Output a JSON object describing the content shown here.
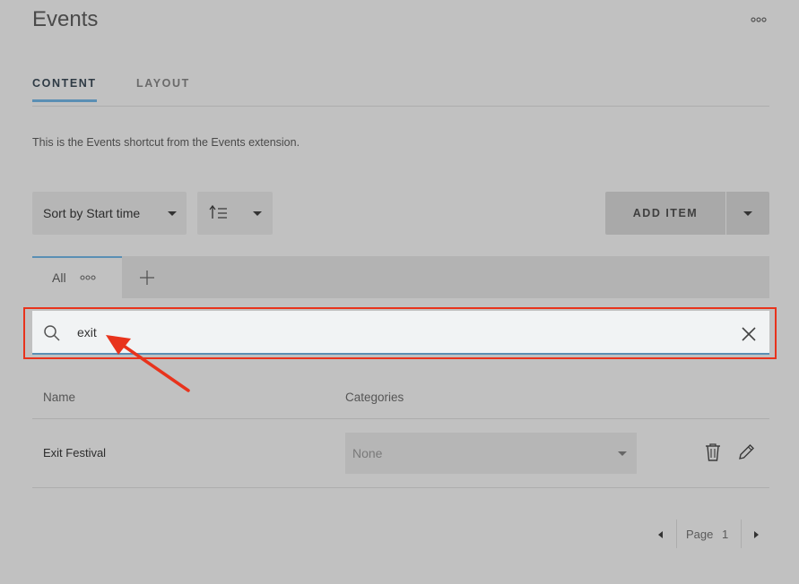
{
  "header": {
    "title": "Events"
  },
  "tabs": [
    {
      "label": "CONTENT"
    },
    {
      "label": "LAYOUT"
    }
  ],
  "description": "This is the Events shortcut from the Events extension.",
  "toolbar": {
    "sort_label": "Sort by Start time",
    "add_label": "ADD ITEM"
  },
  "filters": {
    "all_label": "All"
  },
  "search": {
    "value": "exit"
  },
  "table": {
    "columns": [
      "Name",
      "Categories"
    ],
    "rows": [
      {
        "name": "Exit Festival",
        "category": "None"
      }
    ]
  },
  "pager": {
    "label": "Page",
    "page": "1"
  },
  "colors": {
    "accent": "#5a8fb4",
    "annotation": "#e8331c",
    "background": "#c1c1c1"
  }
}
